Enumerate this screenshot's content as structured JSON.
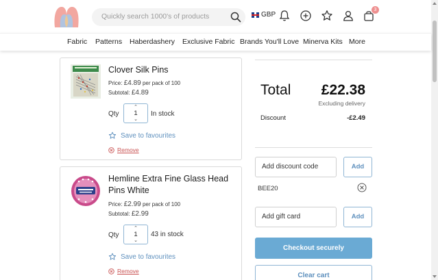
{
  "header": {
    "search_placeholder": "Quickly search 1000's of products",
    "currency": "GBP",
    "cart_count": "3",
    "icons": [
      "search-icon",
      "flag-uk-icon",
      "bell-icon",
      "plus-circle-icon",
      "star-icon",
      "user-icon",
      "bag-icon"
    ]
  },
  "nav": {
    "items": [
      "Fabric",
      "Patterns",
      "Haberdashery",
      "Exclusive Fabric",
      "Brands You'll Love",
      "Minerva Kits",
      "More"
    ]
  },
  "cart": {
    "items": [
      {
        "name": "Clover Silk Pins",
        "price_label": "Price:",
        "price": "£4.89",
        "price_suffix": "per pack of 100",
        "subtotal_label": "Subtotal:",
        "subtotal": "£4.89",
        "qty_label": "Qty",
        "qty": "1",
        "stock": "In stock",
        "favourite": "Save to favourites",
        "remove": "Remove"
      },
      {
        "name": "Hemline Extra Fine Glass Head Pins White",
        "price_label": "Price:",
        "price": "£2.99",
        "price_suffix": "per pack of 100",
        "subtotal_label": "Subtotal:",
        "subtotal": "£2.99",
        "qty_label": "Qty",
        "qty": "1",
        "stock": "43 in stock",
        "favourite": "Save to favourites",
        "remove": "Remove"
      }
    ]
  },
  "summary": {
    "total_label": "Total",
    "total_value": "£22.38",
    "excluding": "Excluding delivery",
    "discount_label": "Discount",
    "discount_value": "-£2.49",
    "discount_code_placeholder": "Add discount code",
    "add_label": "Add",
    "applied_code": "BEE20",
    "gift_card_placeholder": "Add gift card",
    "checkout_label": "Checkout securely",
    "clear_cart_label": "Clear cart"
  },
  "colors": {
    "accent": "#6aaad4",
    "link": "#5d8fbd",
    "remove": "#c85050",
    "badge": "#ee8f8f"
  }
}
